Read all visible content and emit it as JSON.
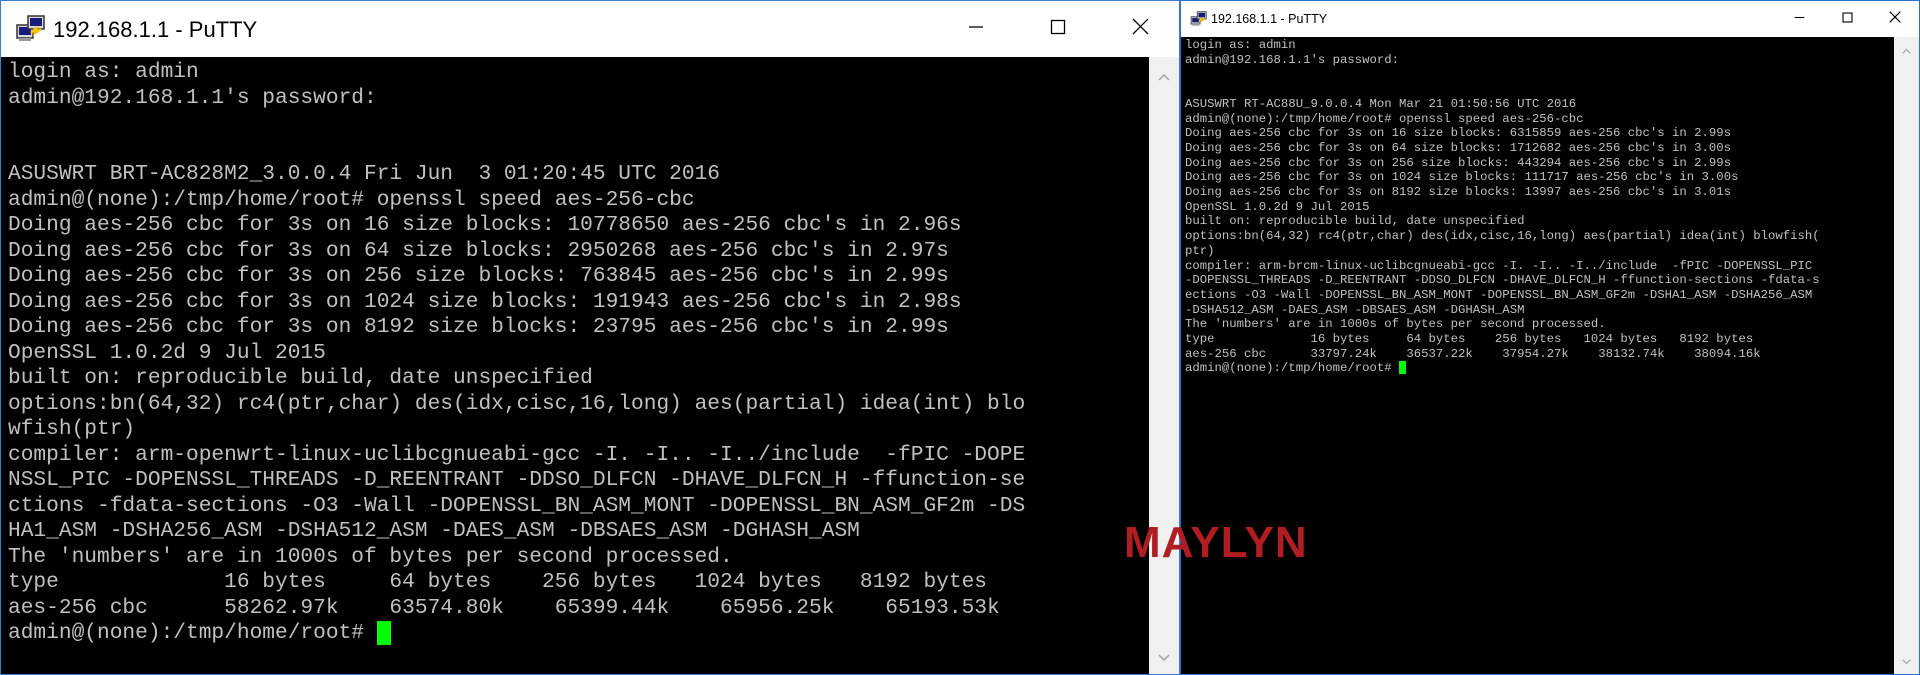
{
  "left_window": {
    "title": "192.168.1.1 - PuTTY",
    "icon": "putty-icon",
    "controls": {
      "minimize": "minimize-icon",
      "maximize": "maximize-icon",
      "close": "close-icon"
    },
    "terminal_lines": [
      "login as: admin",
      "admin@192.168.1.1's password:",
      "",
      "",
      "ASUSWRT BRT-AC828M2_3.0.0.4 Fri Jun  3 01:20:45 UTC 2016",
      "admin@(none):/tmp/home/root# openssl speed aes-256-cbc",
      "Doing aes-256 cbc for 3s on 16 size blocks: 10778650 aes-256 cbc's in 2.96s",
      "Doing aes-256 cbc for 3s on 64 size blocks: 2950268 aes-256 cbc's in 2.97s",
      "Doing aes-256 cbc for 3s on 256 size blocks: 763845 aes-256 cbc's in 2.99s",
      "Doing aes-256 cbc for 3s on 1024 size blocks: 191943 aes-256 cbc's in 2.98s",
      "Doing aes-256 cbc for 3s on 8192 size blocks: 23795 aes-256 cbc's in 2.99s",
      "OpenSSL 1.0.2d 9 Jul 2015",
      "built on: reproducible build, date unspecified",
      "options:bn(64,32) rc4(ptr,char) des(idx,cisc,16,long) aes(partial) idea(int) blo",
      "wfish(ptr)",
      "compiler: arm-openwrt-linux-uclibcgnueabi-gcc -I. -I.. -I../include  -fPIC -DOPE",
      "NSSL_PIC -DOPENSSL_THREADS -D_REENTRANT -DDSO_DLFCN -DHAVE_DLFCN_H -ffunction-se",
      "ctions -fdata-sections -O3 -Wall -DOPENSSL_BN_ASM_MONT -DOPENSSL_BN_ASM_GF2m -DS",
      "HA1_ASM -DSHA256_ASM -DSHA512_ASM -DAES_ASM -DBSAES_ASM -DGHASH_ASM",
      "The 'numbers' are in 1000s of bytes per second processed.",
      "type             16 bytes     64 bytes    256 bytes   1024 bytes   8192 bytes",
      "aes-256 cbc      58262.97k    63574.80k    65399.44k    65956.25k    65193.53k"
    ],
    "prompt": "admin@(none):/tmp/home/root# "
  },
  "right_window": {
    "title": "192.168.1.1 - PuTTY",
    "icon": "putty-icon",
    "controls": {
      "minimize": "minimize-icon",
      "maximize": "maximize-icon",
      "close": "close-icon"
    },
    "terminal_lines": [
      "login as: admin",
      "admin@192.168.1.1's password:",
      "",
      "",
      "ASUSWRT RT-AC88U_9.0.0.4 Mon Mar 21 01:50:56 UTC 2016",
      "admin@(none):/tmp/home/root# openssl speed aes-256-cbc",
      "Doing aes-256 cbc for 3s on 16 size blocks: 6315859 aes-256 cbc's in 2.99s",
      "Doing aes-256 cbc for 3s on 64 size blocks: 1712682 aes-256 cbc's in 3.00s",
      "Doing aes-256 cbc for 3s on 256 size blocks: 443294 aes-256 cbc's in 2.99s",
      "Doing aes-256 cbc for 3s on 1024 size blocks: 111717 aes-256 cbc's in 3.00s",
      "Doing aes-256 cbc for 3s on 8192 size blocks: 13997 aes-256 cbc's in 3.01s",
      "OpenSSL 1.0.2d 9 Jul 2015",
      "built on: reproducible build, date unspecified",
      "options:bn(64,32) rc4(ptr,char) des(idx,cisc,16,long) aes(partial) idea(int) blowfish(",
      "ptr)",
      "compiler: arm-brcm-linux-uclibcgnueabi-gcc -I. -I.. -I../include  -fPIC -DOPENSSL_PIC",
      "-DOPENSSL_THREADS -D_REENTRANT -DDSO_DLFCN -DHAVE_DLFCN_H -ffunction-sections -fdata-s",
      "ections -O3 -Wall -DOPENSSL_BN_ASM_MONT -DOPENSSL_BN_ASM_GF2m -DSHA1_ASM -DSHA256_ASM",
      "-DSHA512_ASM -DAES_ASM -DBSAES_ASM -DGHASH_ASM",
      "The 'numbers' are in 1000s of bytes per second processed.",
      "type             16 bytes     64 bytes    256 bytes   1024 bytes   8192 bytes",
      "aes-256 cbc      33797.24k    36537.22k    37954.27k    38132.74k    38094.16k"
    ],
    "prompt": "admin@(none):/tmp/home/root# "
  },
  "watermark": {
    "text": "MAYLYN",
    "color": "#b01e23"
  },
  "colors": {
    "terminal_bg": "#000000",
    "terminal_fg": "#c0c0c0",
    "cursor": "#00ff00",
    "titlebar_bg": "#ffffff",
    "window_border": "#3a7bd5",
    "scrollbar_bg": "#f0f0f0"
  }
}
